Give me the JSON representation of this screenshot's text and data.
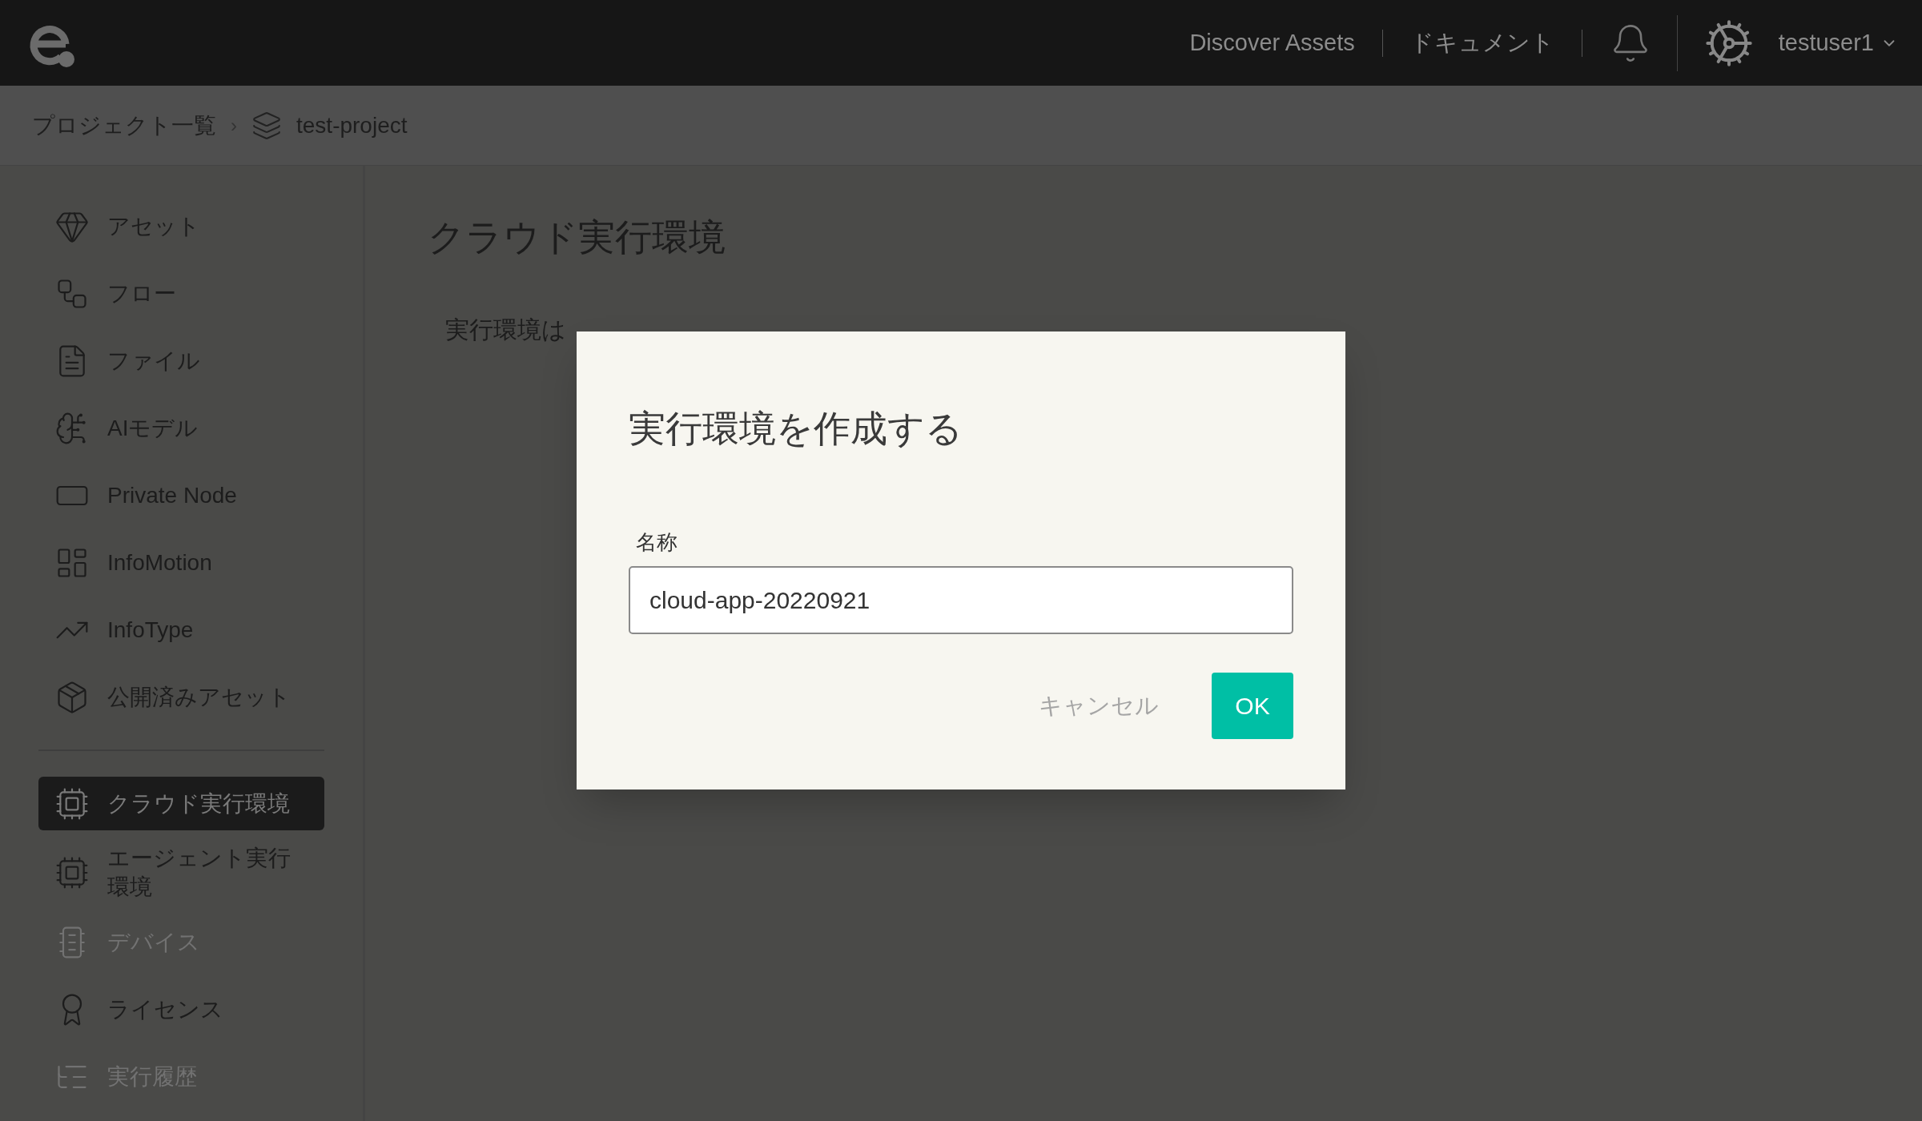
{
  "header": {
    "nav_links": [
      "Discover Assets",
      "ドキュメント"
    ],
    "user": "testuser1"
  },
  "breadcrumb": {
    "items": [
      "プロジェクト一覧",
      "test-project"
    ],
    "separator": "›"
  },
  "sidebar": {
    "groups": [
      [
        {
          "label": "アセット",
          "selected": false,
          "disabled": false
        },
        {
          "label": "フロー",
          "selected": false,
          "disabled": false
        },
        {
          "label": "ファイル",
          "selected": false,
          "disabled": false
        },
        {
          "label": "AIモデル",
          "selected": false,
          "disabled": false
        },
        {
          "label": "Private Node",
          "selected": false,
          "disabled": false
        },
        {
          "label": "InfoMotion",
          "selected": false,
          "disabled": false
        },
        {
          "label": "InfoType",
          "selected": false,
          "disabled": false
        },
        {
          "label": "公開済みアセット",
          "selected": false,
          "disabled": false
        }
      ],
      [
        {
          "label": "クラウド実行環境",
          "selected": true,
          "disabled": false
        },
        {
          "label": "エージェント実行環境",
          "selected": false,
          "disabled": false
        },
        {
          "label": "デバイス",
          "selected": false,
          "disabled": true
        },
        {
          "label": "ライセンス",
          "selected": false,
          "disabled": false
        },
        {
          "label": "実行履歴",
          "selected": false,
          "disabled": true
        }
      ]
    ]
  },
  "page": {
    "title": "クラウド実行環境",
    "text": "実行環境は"
  },
  "dialog": {
    "title": "実行環境を作成する",
    "field": {
      "label": "名称",
      "value": "cloud-app-20220921"
    },
    "cancel": "キャンセル",
    "ok": "OK"
  }
}
